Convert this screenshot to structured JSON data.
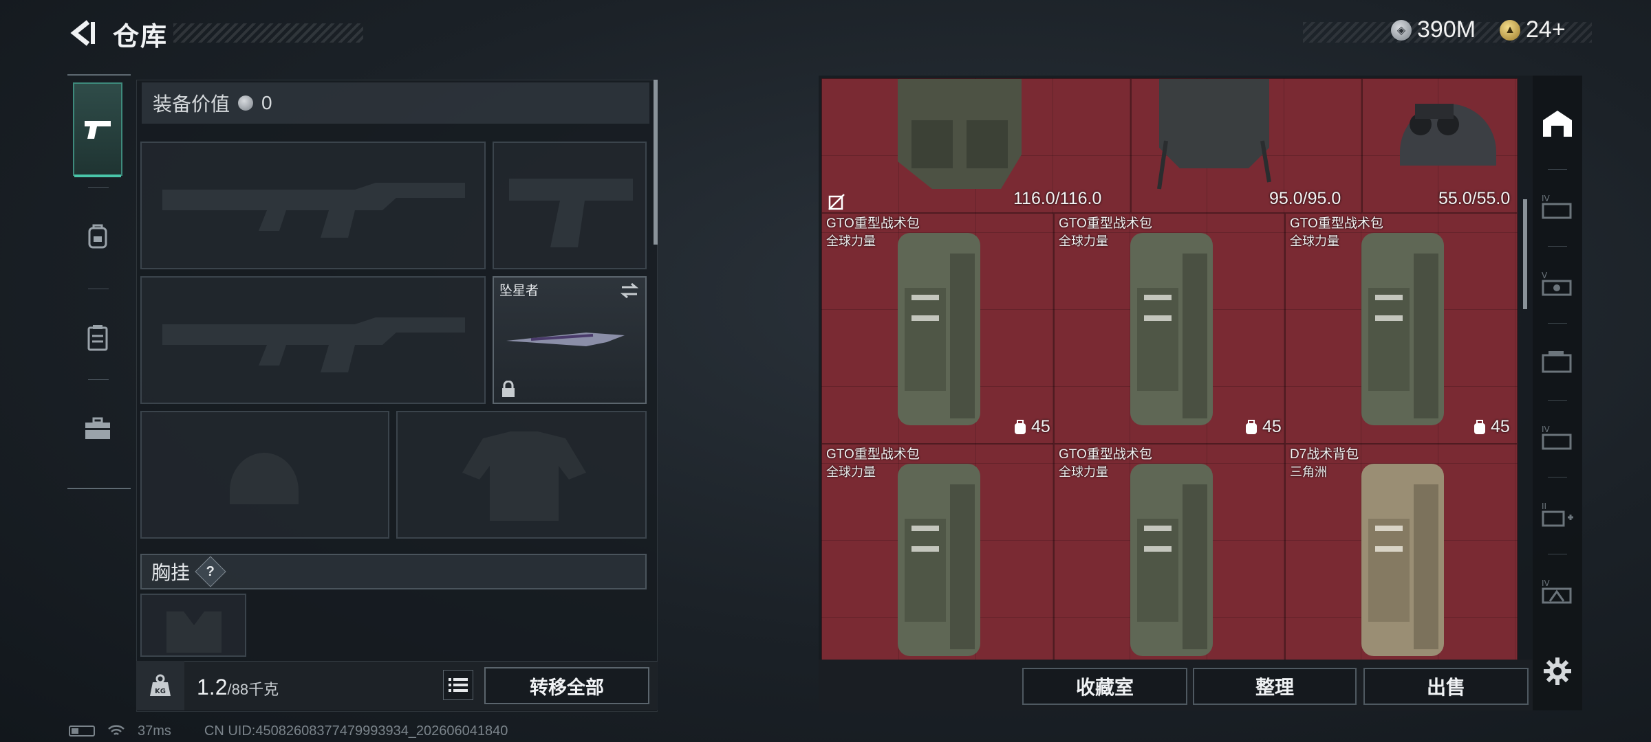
{
  "header": {
    "title": "仓库",
    "currency_silver": "390M",
    "currency_gold": "24+"
  },
  "loadout": {
    "equip_value_label": "装备价值",
    "equip_value": "0",
    "melee_slot_name": "坠星者",
    "chest_rig_label": "胸挂",
    "help_label": "?",
    "weight_value": "1.2",
    "weight_max": "/88千克",
    "transfer_all_label": "转移全部"
  },
  "warehouse": {
    "top_row": [
      {
        "durability": "116.0/116.0"
      },
      {
        "durability": "95.0/95.0"
      },
      {
        "durability": "55.0/55.0"
      }
    ],
    "items": [
      {
        "name": "GTO重型战术包",
        "brand": "全球力量",
        "capacity": "45"
      },
      {
        "name": "GTO重型战术包",
        "brand": "全球力量",
        "capacity": "45"
      },
      {
        "name": "GTO重型战术包",
        "brand": "全球力量",
        "capacity": "45"
      },
      {
        "name": "GTO重型战术包",
        "brand": "全球力量"
      },
      {
        "name": "GTO重型战术包",
        "brand": "全球力量"
      },
      {
        "name": "D7战术背包",
        "brand": "三角洲"
      }
    ],
    "buttons": {
      "collection_room": "收藏室",
      "organize": "整理",
      "sell": "出售"
    }
  },
  "status": {
    "ping": "37ms",
    "uid": "CN UID:450826083774799939​34_202606041840"
  },
  "colors": {
    "accent_teal": "#49c6a9",
    "grid_red": "#7a2a33"
  }
}
